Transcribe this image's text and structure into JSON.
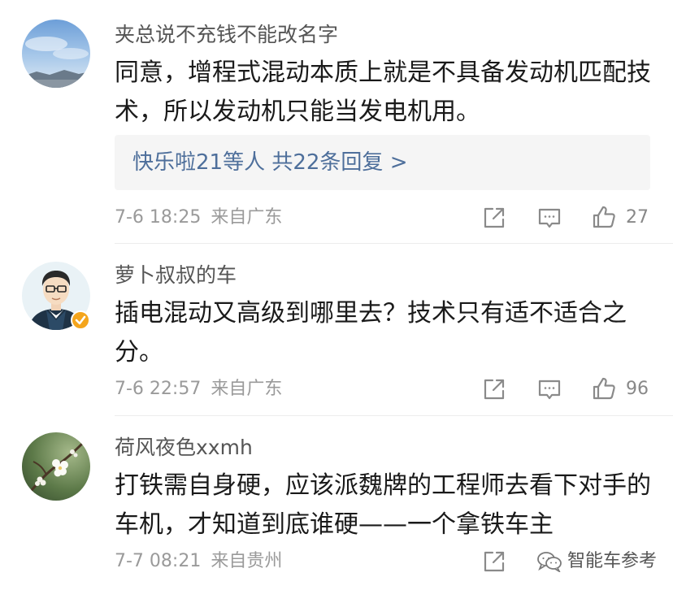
{
  "comments": [
    {
      "username": "夹总说不充钱不能改名字",
      "content": "同意，增程式混动本质上就是不具备发动机匹配技术，所以发动机只能当发电机用。",
      "replies": "快乐啦21等人 共22条回复 >",
      "time": "7-6 18:25",
      "location": "来自广东",
      "likes": "27",
      "verified": false
    },
    {
      "username": "萝卜叔叔的车",
      "content": "插电混动又高级到哪里去？技术只有适不适合之分。",
      "time": "7-6 22:57",
      "location": "来自广东",
      "likes": "96",
      "verified": true
    },
    {
      "username": "荷风夜色xxmh",
      "content": "打铁需自身硬，应该派魏牌的工程师去看下对手的车机，才知道到底谁硬——一个拿铁车主",
      "time": "7-7 08:21",
      "location": "来自贵州"
    }
  ],
  "watermark": {
    "text": "智能车参考"
  },
  "colors": {
    "link": "#4e6f9b",
    "meta": "#9a9a9a",
    "verified_badge": "#f4a51c",
    "reply_bg": "#f5f5f5"
  },
  "icons": {
    "share": "share-icon",
    "comment": "comment-icon",
    "like": "thumbs-up-icon",
    "badge": "verified-badge-icon",
    "watermark": "wechat-icon"
  }
}
